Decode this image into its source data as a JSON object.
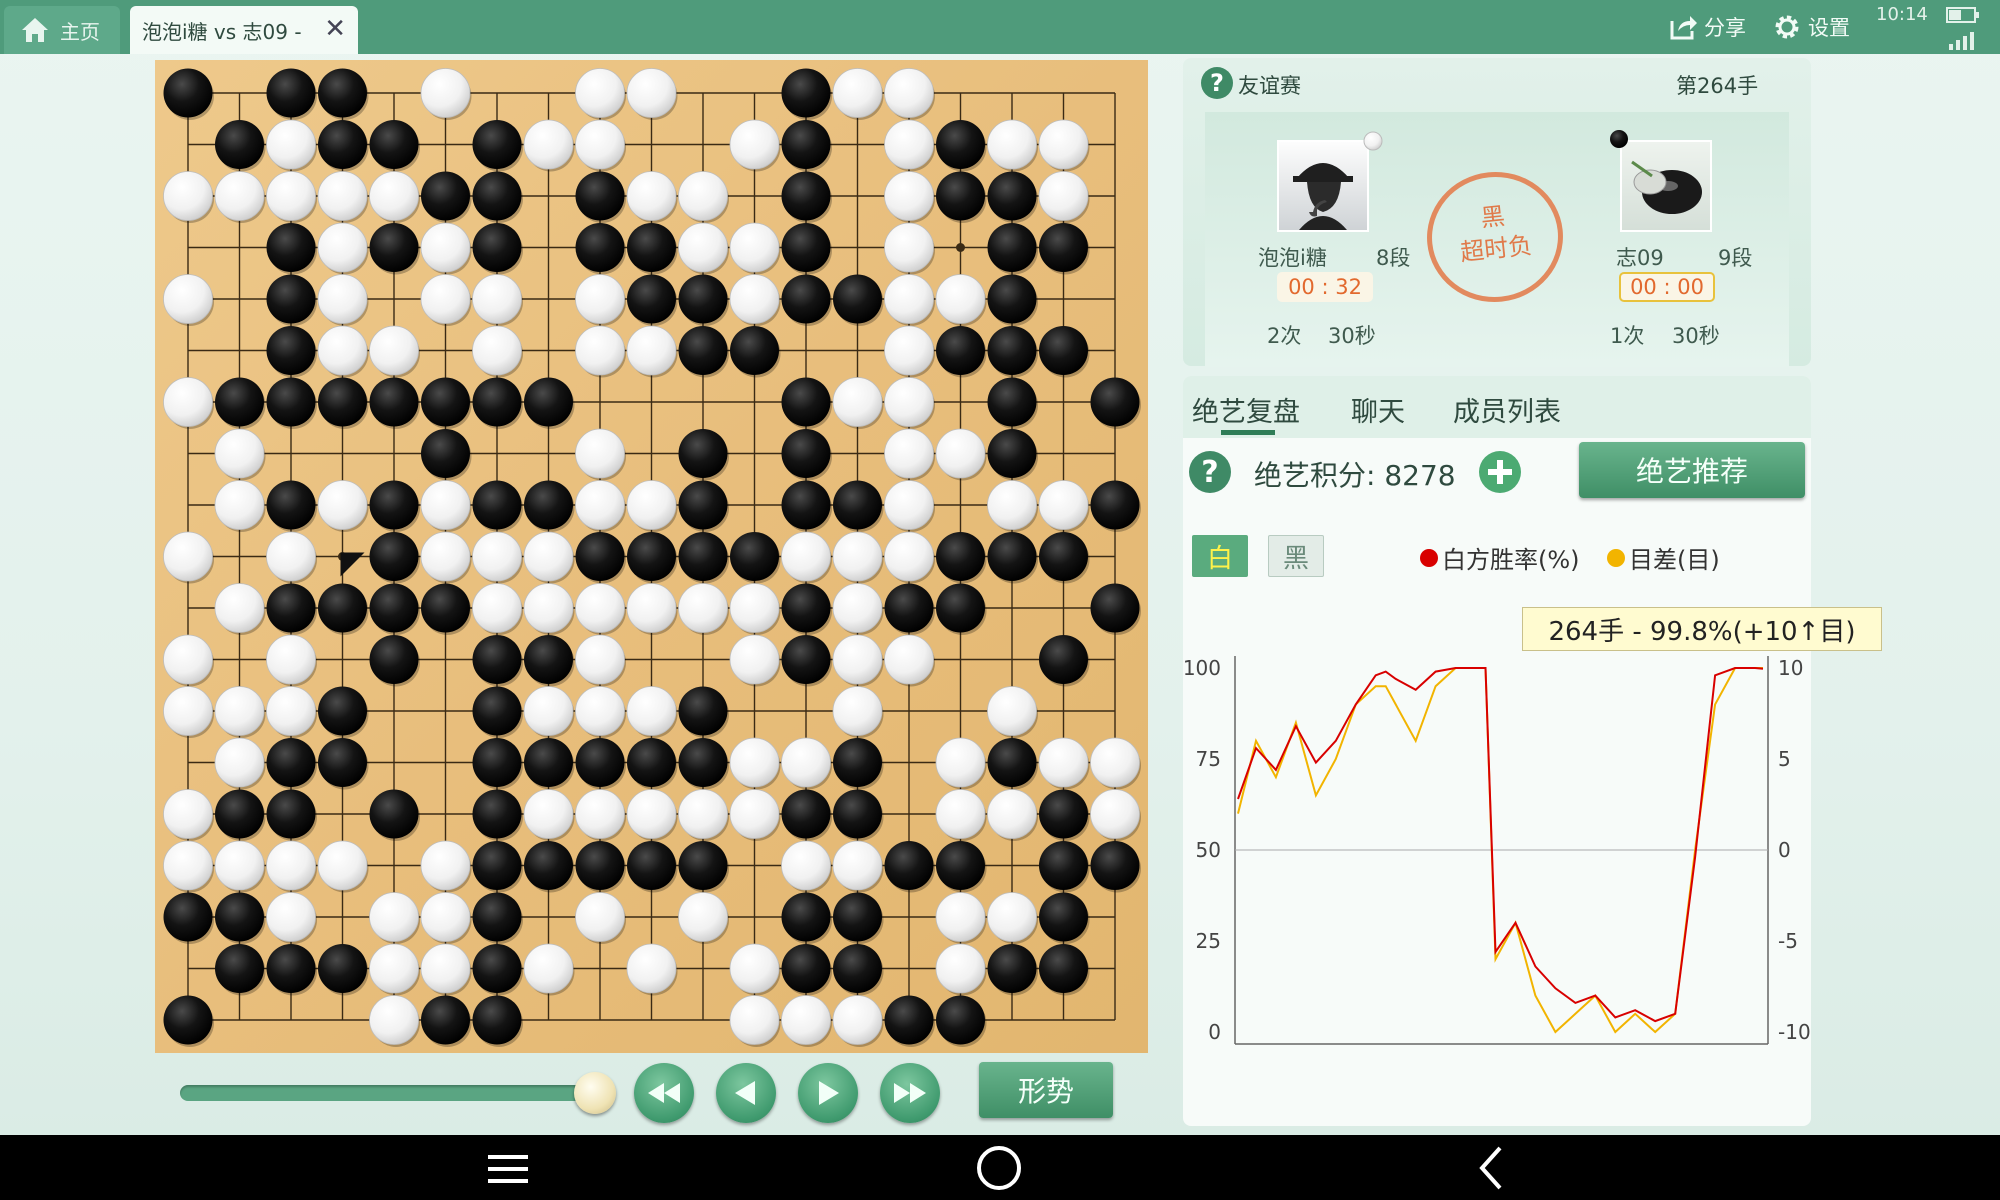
{
  "tabs": {
    "home_label": "主页",
    "game_label": "泡泡i糖 vs 志09 -"
  },
  "topbar": {
    "share_label": "分享",
    "settings_label": "设置",
    "time": "10:14"
  },
  "game": {
    "type_label": "友谊赛",
    "move_label": "第264手",
    "result_line1": "黑",
    "result_line2": "超时负",
    "left_player": {
      "name": "泡泡i糖",
      "rank": "8段",
      "timer": "00 : 32",
      "periods": "2次",
      "byoyomi": "30秒"
    },
    "right_player": {
      "name": "志09",
      "rank": "9段",
      "timer": "00 : 00",
      "periods": "1次",
      "byoyomi": "30秒"
    }
  },
  "board": {
    "size": 19,
    "rows": [
      "b.bb.w..ww..bww....",
      ".bwbb.bww..wb.wbww.",
      "wwwwwbb.bww.b.wbbw.",
      "..bwbwb.bbwwb.w.bb.",
      "w.bw.ww.wbbwbbwwb..",
      "..bww.w.wwbb..wbbb.",
      "wbbbbbbb....bww.b.b",
      ".w...b..w.b.b.wwb..",
      ".wbwbwbbwwb.bbw.wwb",
      "w.w.bwwwbbbbwwwbbb.",
      ".wbbbbwwwwwwbwbb..b",
      "w.w.b.bbw..wbww..b.",
      "wwwb..bwwwb..w..w..",
      ".wbb..bbbbbwwb.wbww.",
      "wbb.b.bwwwwwbb.wwbw",
      "wwww.wbbbbb.wwbb.bb.",
      "bbw.wwb.w.w.bb.wwb.b",
      ".bbbwwbw.w.wbb.wbb.",
      "b...wbb....wwwbb..."
    ],
    "last_move": "3-9"
  },
  "panel_tabs": {
    "replay": "绝艺复盘",
    "chat": "聊天",
    "members": "成员列表"
  },
  "score": {
    "label": "绝艺积分: 8278",
    "recommend_label": "绝艺推荐"
  },
  "side_toggle": {
    "white": "白",
    "black": "黑"
  },
  "legend": {
    "win_rate": "白方胜率(%)",
    "margin": "目差(目)",
    "win_color": "#d80000",
    "margin_color": "#f2b400"
  },
  "tooltip": "264手 - 99.8%(+10↑目)",
  "controls": {
    "judge_label": "形势"
  },
  "chart_data": {
    "type": "line",
    "x": [
      1,
      10,
      20,
      30,
      40,
      50,
      60,
      70,
      75,
      80,
      90,
      100,
      110,
      120,
      125,
      130,
      140,
      150,
      160,
      170,
      180,
      190,
      200,
      210,
      220,
      230,
      240,
      250,
      260,
      264
    ],
    "series": [
      {
        "name": "白方胜率(%)",
        "values": [
          64,
          78,
          72,
          84,
          74,
          80,
          90,
          98,
          99,
          97,
          94,
          99,
          100,
          100,
          100,
          22,
          30,
          18,
          12,
          8,
          10,
          4,
          6,
          3,
          5,
          48,
          98,
          100,
          100,
          99.8
        ]
      },
      {
        "name": "目差(目)",
        "values": [
          2,
          6,
          4,
          7,
          3,
          5,
          8,
          9,
          9,
          8,
          6,
          9,
          10,
          10,
          10,
          -6,
          -4,
          -8,
          -10,
          -9,
          -8,
          -10,
          -9,
          -10,
          -9,
          0,
          8,
          10,
          10,
          10
        ]
      }
    ],
    "y_left": {
      "ticks": [
        0,
        25,
        50,
        75,
        100
      ],
      "range": [
        0,
        100
      ]
    },
    "y_right": {
      "ticks": [
        -10,
        -5,
        0,
        5,
        10
      ],
      "range": [
        -10,
        10
      ]
    },
    "xlim": [
      1,
      264
    ],
    "grid": "baseline at 50"
  }
}
